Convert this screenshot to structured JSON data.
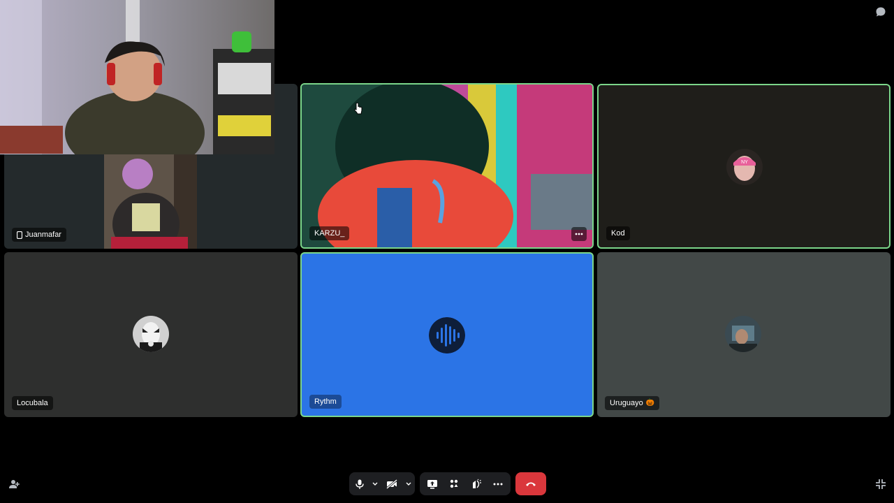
{
  "participants": [
    {
      "name": "Juanmafar",
      "icon": "phone-icon",
      "state": "video"
    },
    {
      "name": "KARZU_",
      "state": "video",
      "speaking": true
    },
    {
      "name": "Kod",
      "state": "avatar",
      "speaking": true
    },
    {
      "name": "Locubala",
      "state": "avatar"
    },
    {
      "name": "Rythm",
      "state": "bot-avatar",
      "speaking": true
    },
    {
      "name": "Uruguayo",
      "emoji": "🎃",
      "state": "avatar"
    }
  ],
  "toolbar": {
    "microphone": "microphone-icon",
    "camera": "camera-off-icon",
    "screen_share": "screen-share-icon",
    "activities": "activities-icon",
    "soundboard": "soundboard-icon",
    "more": "more-options-icon",
    "disconnect": "hang-up-icon"
  },
  "colors": {
    "speaking_border": "#7bd68a",
    "rythm_tile": "#2b74e6",
    "disconnect": "#da373c"
  }
}
